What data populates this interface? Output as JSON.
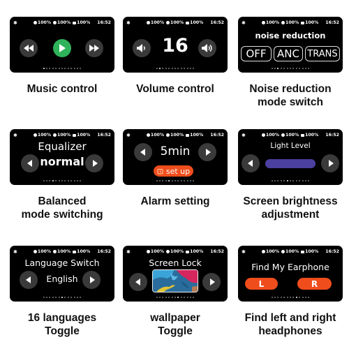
{
  "status_bar": {
    "bluetooth_icon": "bluetooth-icon",
    "items": [
      {
        "icon": "left-earbud-icon",
        "value": "100%"
      },
      {
        "icon": "right-earbud-icon",
        "value": "100%"
      },
      {
        "icon": "case-battery-icon",
        "value": "100%"
      }
    ],
    "time": "16:52"
  },
  "page_dots_total": 13,
  "colors": {
    "screen_bg": "#000000",
    "button_bg": "#3a3a3a",
    "play_green": "#2fb35a",
    "accent_orange": "#f04d1d",
    "light_level_purple": "#4b3fa0",
    "caption_text": "#111111"
  },
  "screens": {
    "music": {
      "active_dot": 0,
      "prev_icon": "rewind-icon",
      "play_icon": "play-icon",
      "next_icon": "fast-forward-icon",
      "caption_line1": "Music control",
      "caption_line2": ""
    },
    "volume": {
      "active_dot": 1,
      "value": "16",
      "down_icon": "volume-down-icon",
      "up_icon": "volume-up-icon",
      "caption_line1": "Volume control",
      "caption_line2": ""
    },
    "noise": {
      "active_dot": 2,
      "title": "noise reduction",
      "options": [
        "OFF",
        "ANC",
        "TRANS"
      ],
      "caption_line1": "Noise reduction",
      "caption_line2": "mode switch"
    },
    "equalizer": {
      "active_dot": 3,
      "title": "Equalizer",
      "value": "normal",
      "caption_line1": "Balanced",
      "caption_line2": "mode switching"
    },
    "alarm": {
      "active_dot": 4,
      "value": "5min",
      "button_label": "set up",
      "button_icon": "alarm-clock-icon",
      "caption_line1": "Alarm setting",
      "caption_line2": ""
    },
    "light": {
      "active_dot": 5,
      "title": "Light Level",
      "level_fraction": 1.0,
      "caption_line1": "Screen brightness",
      "caption_line2": "adjustment"
    },
    "language": {
      "active_dot": 6,
      "title": "Language Switch",
      "value": "English",
      "caption_line1": "16 languages",
      "caption_line2": "Toggle"
    },
    "wallpaper": {
      "active_dot": 7,
      "title": "Screen Lock",
      "image": "wallpaper-thumbnail",
      "caption_line1": "wallpaper",
      "caption_line2": "Toggle"
    },
    "find": {
      "active_dot": 8,
      "title": "Find My Earphone",
      "left_label": "L",
      "right_label": "R",
      "caption_line1": "Find left and right",
      "caption_line2": "headphones"
    }
  }
}
